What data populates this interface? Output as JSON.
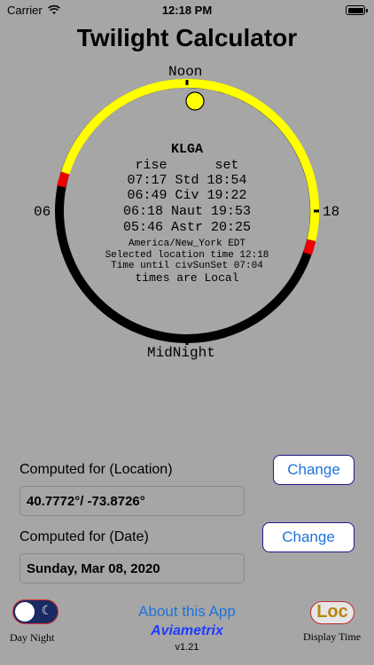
{
  "status_bar": {
    "carrier": "Carrier",
    "time": "12:18 PM"
  },
  "app": {
    "title": "Twilight Calculator"
  },
  "dial": {
    "label_noon": "Noon",
    "label_midnight": "MidNight",
    "label_left": "06",
    "label_right": "18",
    "station": "KLGA",
    "header": "rise      set",
    "rows": [
      "07:17 Std 18:54",
      "06:49 Civ 19:22",
      "06:18 Naut 19:53",
      "05:46 Astr 20:25"
    ],
    "timezone": "America/New_York EDT",
    "selected_time": "Selected location time 12:18",
    "time_until": "Time until civSunSet 07:04",
    "times_mode": "times are Local"
  },
  "location": {
    "label": "Computed for (Location)",
    "value": "40.7772°/ -73.8726°",
    "button": "Change"
  },
  "date": {
    "label": "Computed for (Date)",
    "value": "Sunday, Mar 08, 2020",
    "button": "Change"
  },
  "footer": {
    "day_night_label": "Day Night",
    "about": "About this App",
    "brand": "Aviametrix",
    "version": "v1.21",
    "loc_button": "Loc",
    "display_time_label": "Display Time"
  }
}
